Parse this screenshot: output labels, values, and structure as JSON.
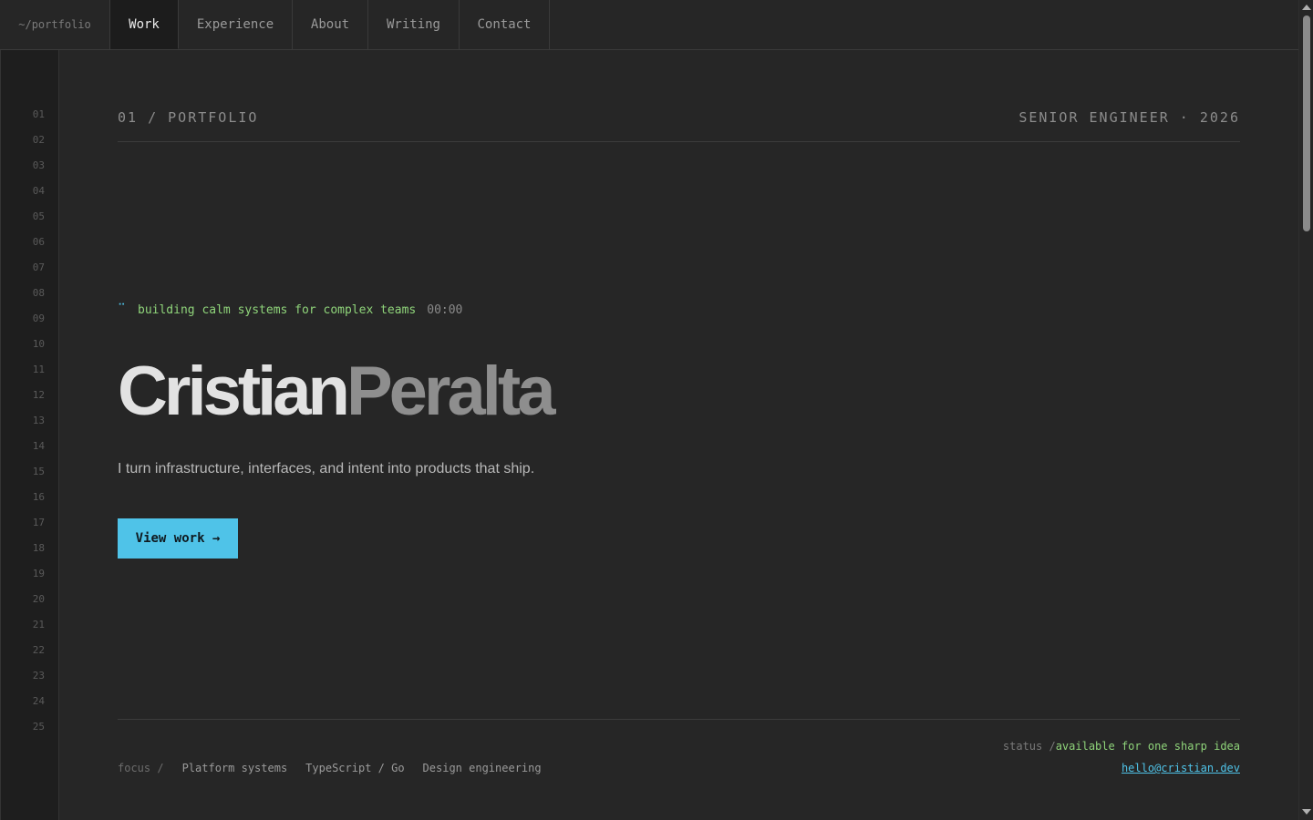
{
  "nav": {
    "brand": "~/portfolio",
    "tabs": [
      {
        "label": "Work",
        "active": true
      },
      {
        "label": "Experience",
        "active": false
      },
      {
        "label": "About",
        "active": false
      },
      {
        "label": "Writing",
        "active": false
      },
      {
        "label": "Contact",
        "active": false
      }
    ]
  },
  "gutter": {
    "line_numbers": [
      "01",
      "02",
      "03",
      "04",
      "05",
      "06",
      "07",
      "08",
      "09",
      "10",
      "11",
      "12",
      "13",
      "14",
      "15",
      "16",
      "17",
      "18",
      "19",
      "20",
      "21",
      "22",
      "23",
      "24",
      "25"
    ]
  },
  "header": {
    "section": "01 / PORTFOLIO",
    "role": "SENIOR ENGINEER · 2026"
  },
  "hero": {
    "tagline": "building calm systems for complex teams",
    "clock": "00:00",
    "first_name": "Cristian",
    "last_name": "Peralta",
    "subline": "I turn infrastructure, interfaces, and intent into products that ship.",
    "cta_label": "View work →"
  },
  "footer": {
    "focus_label": "focus /",
    "focus_items": [
      "Platform systems",
      "TypeScript / Go",
      "Design engineering"
    ],
    "status_label": "status /",
    "status_value": "available for one sharp idea",
    "email": "hello@cristian.dev"
  },
  "colors": {
    "accent": "#4fc3e8",
    "green": "#8fd47a",
    "background": "#262626"
  }
}
